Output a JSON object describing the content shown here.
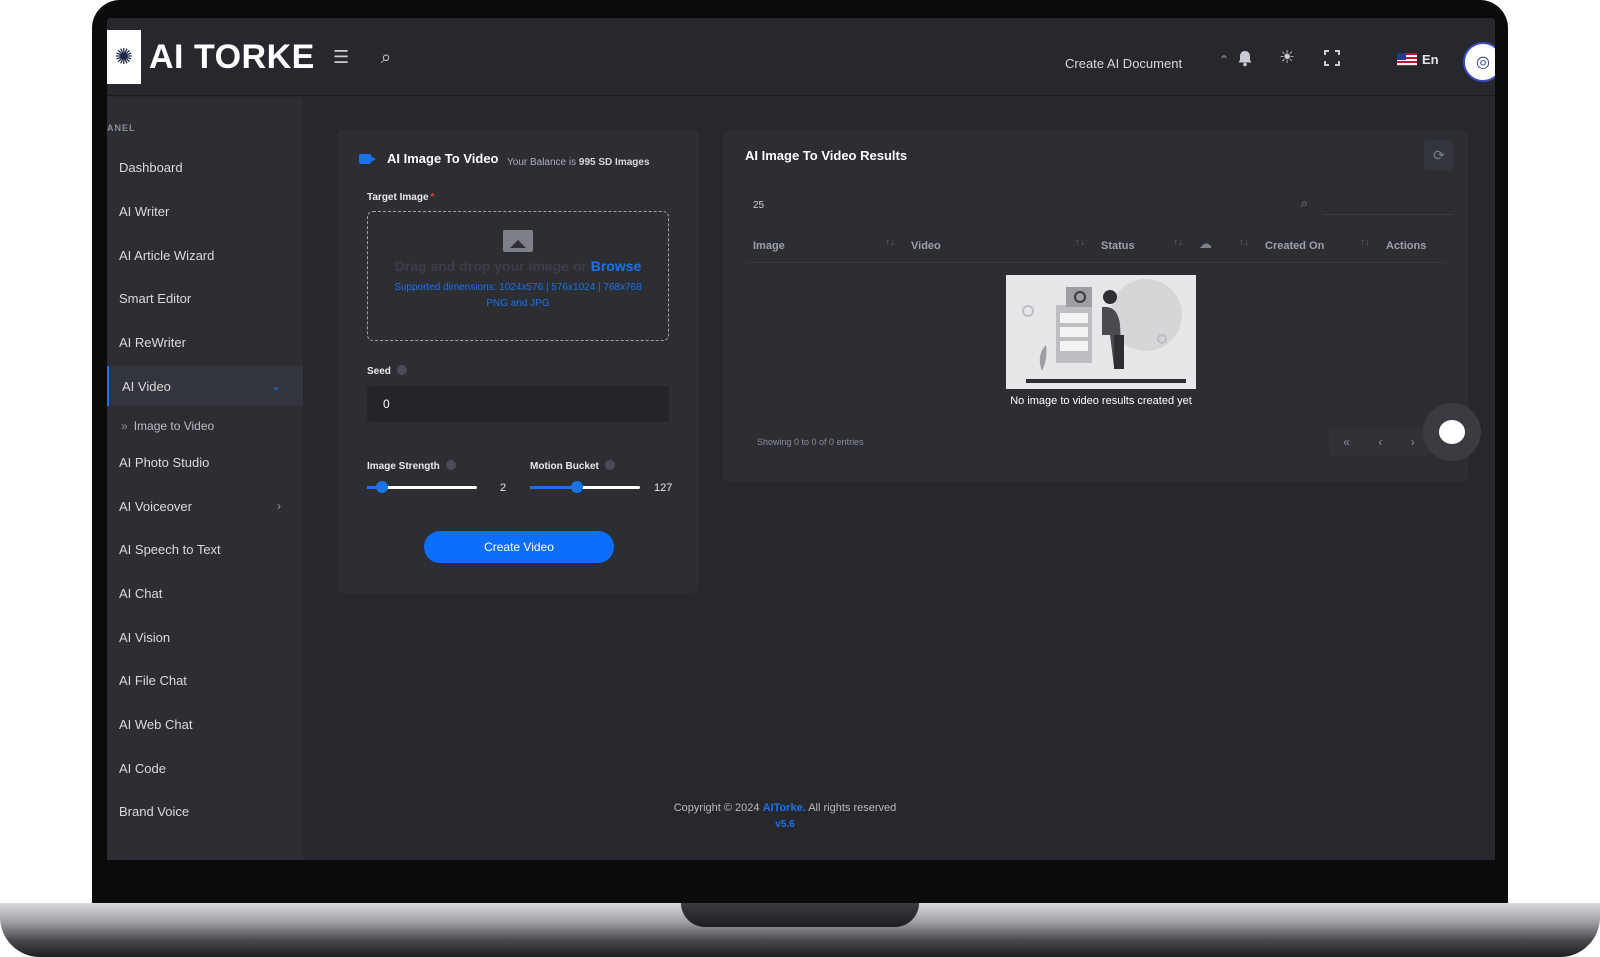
{
  "header": {
    "logo_icon": "brain-icon",
    "logo_text": "AI TORKE",
    "menu_icon": "☰",
    "search_icon": "⌕",
    "create_doc_label": "Create AI Document",
    "create_doc_caret": "⌃",
    "bell_icon": "🔔",
    "theme_icon": "☀",
    "fullscreen_icon": "⛶",
    "language": "En",
    "avatar_glyph": "◎"
  },
  "sidebar": {
    "panel_label": "ANEL",
    "items": [
      {
        "label": "Dashboard"
      },
      {
        "label": "AI Writer"
      },
      {
        "label": "AI Article Wizard"
      },
      {
        "label": "Smart Editor"
      },
      {
        "label": "AI ReWriter"
      },
      {
        "label": "AI Video"
      },
      {
        "label": "AI Photo Studio"
      },
      {
        "label": "AI Voiceover"
      },
      {
        "label": "AI Speech to Text"
      },
      {
        "label": "AI Chat"
      },
      {
        "label": "AI Vision"
      },
      {
        "label": "AI File Chat"
      },
      {
        "label": "AI Web Chat"
      },
      {
        "label": "AI Code"
      },
      {
        "label": "Brand Voice"
      }
    ],
    "sub_item": "Image to Video",
    "sub_bullet": "»",
    "arrow_down": "⌄",
    "arrow_right": "›"
  },
  "form": {
    "title": "AI Image To Video",
    "balance_prefix": "Your Balance is",
    "balance_value": "995 SD Images",
    "target_label": "Target Image",
    "required_mark": "*",
    "drag_text": "Drag and drop your image or",
    "browse_text": "Browse",
    "dims_text": "Supported dimensions: 1024x576 | 576x1024 | 768x768",
    "formats_text": "PNG and JPG",
    "seed_label": "Seed",
    "seed_value": "0",
    "strength_label": "Image Strength",
    "strength_value": "2",
    "strength_fraction": 0.14,
    "motion_label": "Motion Bucket",
    "motion_value": "127",
    "motion_fraction": 0.43,
    "create_button": "Create Video"
  },
  "results": {
    "title": "AI Image To Video Results",
    "refresh_icon": "⟳",
    "entries": "25",
    "search_icon": "⌕",
    "columns": [
      "Image",
      "Video",
      "Status",
      "Created On",
      "Actions"
    ],
    "sort_icon": "↑↓",
    "cloud_icon": "☁",
    "empty_text": "No image to video results created yet",
    "showing_text": "Showing 0 to 0 of 0 entries",
    "pager": [
      "«",
      "‹",
      "›"
    ]
  },
  "footer": {
    "copyright_prefix": "Copyright © 2024",
    "brand": "AITorke.",
    "suffix": "All rights reserved",
    "version": "v5.6"
  },
  "colors": {
    "accent": "#1a73e8",
    "background": "#26282d",
    "card": "#2c2e34",
    "required": "#e53935"
  }
}
